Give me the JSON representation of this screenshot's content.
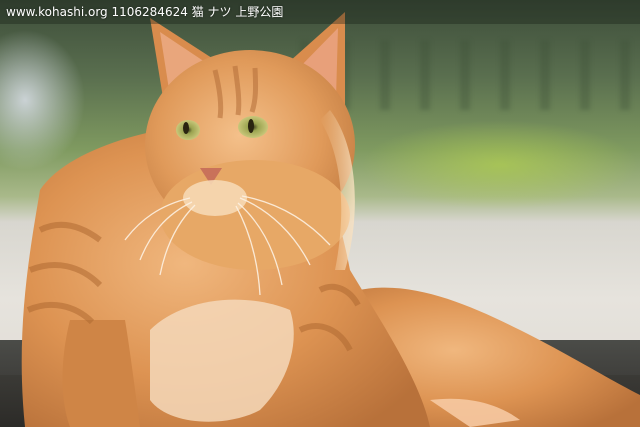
{
  "caption": {
    "site": "www.kohashi.org",
    "photo_id": "1106284624",
    "category": "猫",
    "cat_name": "ナツ",
    "location": "上野公園"
  },
  "colors": {
    "fur_orange": "#e09a5a",
    "fur_light": "#f3c9a0",
    "background_green": "#7f9a60",
    "ground": "#dedad2",
    "ledge": "#3b3a37"
  }
}
